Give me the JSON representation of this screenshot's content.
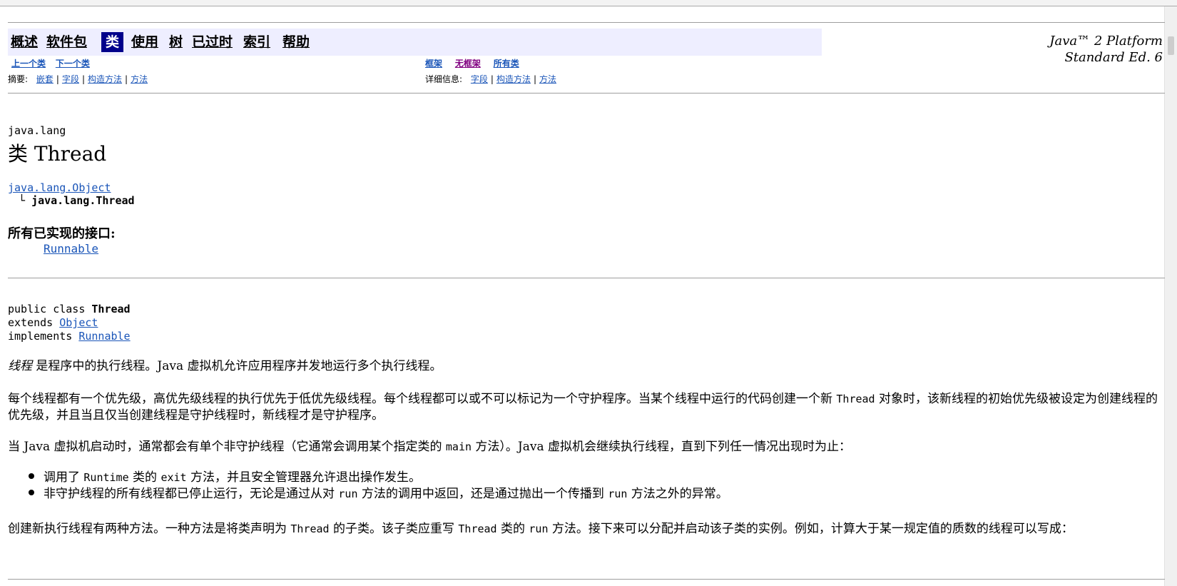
{
  "nav": {
    "items": [
      "概述",
      "软件包",
      "类",
      "使用",
      "树",
      "已过时",
      "索引",
      "帮助"
    ],
    "active_index": 2
  },
  "platform": {
    "line1": "Java™ 2 Platform",
    "line2": "Standard Ed. 6"
  },
  "subnav": {
    "prev_class": "上一个类",
    "next_class": "下一个类",
    "frames": "框架",
    "no_frames": "无框架",
    "all_classes": "所有类",
    "summary_label": "摘要:",
    "summary_links": [
      "嵌套",
      "字段",
      "构造方法",
      "方法"
    ],
    "detail_label": "详细信息:",
    "detail_links": [
      "字段",
      "构造方法",
      "方法"
    ],
    "separator": "|"
  },
  "class_info": {
    "package": "java.lang",
    "title": "类 Thread",
    "hierarchy_parent": "java.lang.Object",
    "hierarchy_branch": "└",
    "hierarchy_child": "java.lang.Thread",
    "interfaces_label": "所有已实现的接口:",
    "interface": "Runnable"
  },
  "declaration": {
    "prefix": "public class ",
    "name": "Thread",
    "extends_kw": "extends ",
    "extends_link": "Object",
    "implements_kw": "implements ",
    "implements_link": "Runnable"
  },
  "description": {
    "p1_em": "线程",
    "p1_rest": " 是程序中的执行线程。Java 虚拟机允许应用程序并发地运行多个执行线程。",
    "p2_a": "每个线程都有一个优先级，高优先级线程的执行优先于低优先级线程。每个线程都可以或不可以标记为一个守护程序。当某个线程中运行的代码创建一个新 ",
    "p2_code": "Thread",
    "p2_b": " 对象时，该新线程的初始优先级被设定为创建线程的优先级，并且当且仅当创建线程是守护线程时，新线程才是守护程序。",
    "p3_a": "当 Java 虚拟机启动时，通常都会有单个非守护线程（它通常会调用某个指定类的 ",
    "p3_code": "main",
    "p3_b": " 方法）。Java 虚拟机会继续执行线程，直到下列任一情况出现时为止：",
    "li1_a": "调用了 ",
    "li1_code1": "Runtime",
    "li1_b": " 类的 ",
    "li1_code2": "exit",
    "li1_c": " 方法，并且安全管理器允许退出操作发生。",
    "li2_a": "非守护线程的所有线程都已停止运行，无论是通过从对 ",
    "li2_code1": "run",
    "li2_b": " 方法的调用中返回，还是通过抛出一个传播到 ",
    "li2_code2": "run",
    "li2_c": " 方法之外的异常。",
    "p4_a": "创建新执行线程有两种方法。一种方法是将类声明为 ",
    "p4_code1": "Thread",
    "p4_b": " 的子类。该子类应重写 ",
    "p4_code2": "Thread",
    "p4_c": " 类的 ",
    "p4_code3": "run",
    "p4_d": " 方法。接下来可以分配并启动该子类的实例。例如，计算大于某一规定值的质数的线程可以写成："
  }
}
